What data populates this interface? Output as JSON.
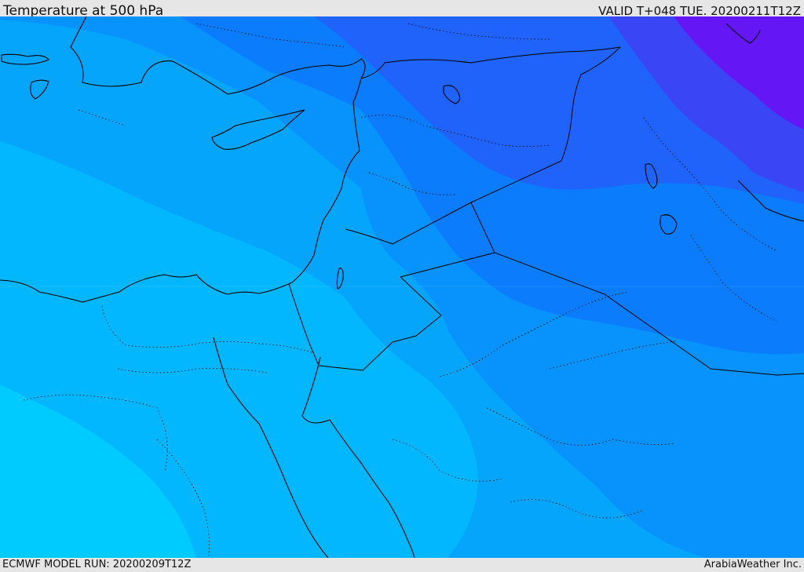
{
  "header": {
    "title": "Temperature at 500 hPa",
    "valid": "VALID T+048 TUE. 20200211T12Z"
  },
  "footer": {
    "model_run": "ECMWF MODEL RUN: 20200209T12Z",
    "provider": "ArabiaWeather Inc."
  },
  "colors": {
    "band_1_coldest": "#6416f5",
    "band_2": "#3a45f5",
    "band_3": "#1f63fa",
    "band_4": "#0a7cfc",
    "band_5": "#0892fb",
    "band_6": "#05a5fc",
    "band_7": "#02b7fe",
    "band_8_warmest": "#00cbff",
    "coastline": "#000000",
    "frame": "#e6e6e6"
  }
}
